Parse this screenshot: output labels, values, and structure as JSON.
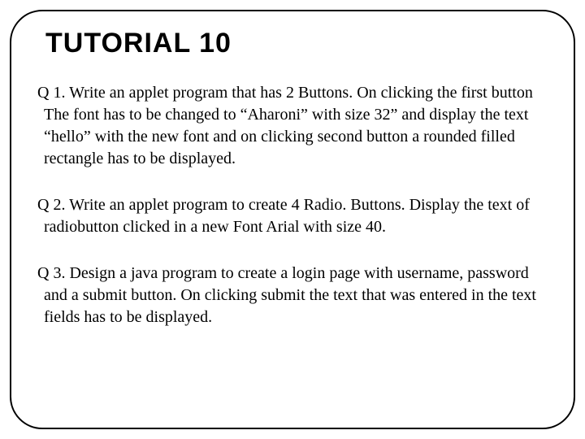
{
  "title": "TUTORIAL 10",
  "questions": {
    "q1": "Q 1. Write an applet program that has 2 Buttons. On clicking the first button The font has to be changed to “Aharoni” with size 32” and display the text “hello” with the new font and on clicking second button a rounded filled rectangle has to be displayed.",
    "q2": "Q 2. Write an applet program to create 4 Radio. Buttons. Display the text of radiobutton clicked in a new Font Arial with size 40.",
    "q3": "Q 3. Design a java program to create a login page with username, password and a submit button. On clicking submit the text that was entered in the text fields has to be displayed."
  }
}
